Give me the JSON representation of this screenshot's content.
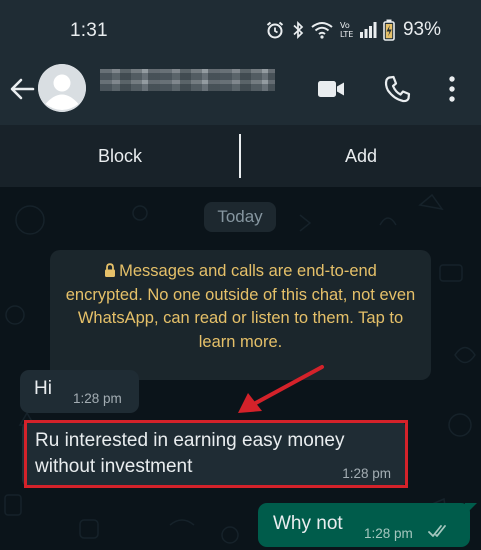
{
  "status_bar": {
    "time": "1:31",
    "battery_percent": "93%",
    "icons": [
      "alarm-icon",
      "bluetooth-icon",
      "wifi-icon",
      "volte-icon",
      "signal-icon",
      "battery-charging-icon"
    ]
  },
  "header": {
    "contact_name_redacted": true,
    "icons": [
      "back-arrow-icon",
      "default-avatar-icon",
      "video-call-icon",
      "voice-call-icon",
      "more-options-icon"
    ]
  },
  "action_bar": {
    "block_label": "Block",
    "add_label": "Add"
  },
  "chat": {
    "date_chip": "Today",
    "encryption_notice": "Messages and calls are end-to-end encrypted. No one outside of this chat, not even WhatsApp, can read or listen to them. Tap to learn more.",
    "messages": [
      {
        "direction": "incoming",
        "text": "Hi",
        "time": "1:28 pm"
      },
      {
        "direction": "incoming",
        "text": "Ru interested in earning easy money without investment",
        "time": "1:28 pm",
        "highlighted": true
      },
      {
        "direction": "outgoing",
        "text": "Why not",
        "time": "1:28 pm",
        "status": "read"
      }
    ]
  },
  "colors": {
    "header_bg": "#1f2c34",
    "chat_bg": "#0b141a",
    "incoming_bubble": "#1f2c34",
    "outgoing_bubble": "#005c4b",
    "notice_text": "#e5c069",
    "read_ticks": "#8696a0",
    "annotation_red": "#d4222a"
  }
}
